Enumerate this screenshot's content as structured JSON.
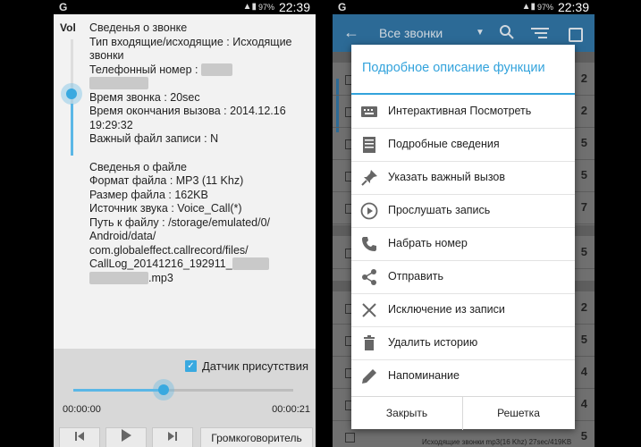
{
  "status_bar": {
    "app_letter": "G",
    "battery": "97%",
    "time": "22:39"
  },
  "left": {
    "vol_label": "Vol",
    "volume_level": 0.45,
    "call_info_header": "Сведенья о звонке",
    "type_line": "Тип входящие/исходящие : Исходящие звонки",
    "phone_label": "Телефонный номер :",
    "call_time_line": "Время звонка : 20sec",
    "end_time_line": "Время окончания вызова : 2014.12.16 19:29:32",
    "important_line": "Важный файл записи : N",
    "file_info_header": "Сведенья о файле",
    "format_line": "Формат файла : MP3 (11 Khz)",
    "size_line": "Размер файла : 162KB",
    "source_line": "Источник звука : Voice_Call(*)",
    "path_line": "Путь к файлу : /storage/emulated/0/ Android/data/ com.globaleffect.callrecord/files/ CallLog_20141216_192911_",
    "path_end": ".mp3",
    "sensor_label": "Датчик присутствия",
    "sensor_checked": true,
    "progress": 0.41,
    "time_start": "00:00:00",
    "time_end": "00:00:21",
    "speaker_label": "Громкоговоритель"
  },
  "right": {
    "appbar_title": "Все звонки",
    "back_icon": "arrow-left-icon",
    "bottom_row": "Исходящие звонки mp3(16 Khz) 27sec/419KB",
    "dialog": {
      "title": "Подробное описание функции",
      "items": [
        {
          "label": "Интерактивная Посмотреть",
          "icon": "keyboard-icon"
        },
        {
          "label": "Подробные сведения",
          "icon": "details-icon"
        },
        {
          "label": "Указать важный вызов",
          "icon": "pin-icon"
        },
        {
          "label": "Прослушать запись",
          "icon": "play-icon"
        },
        {
          "label": "Набрать номер",
          "icon": "phone-icon"
        },
        {
          "label": "Отправить",
          "icon": "share-icon"
        },
        {
          "label": "Исключение из записи",
          "icon": "close-icon"
        },
        {
          "label": "Удалить историю",
          "icon": "trash-icon"
        },
        {
          "label": "Напоминание",
          "icon": "pencil-icon"
        }
      ],
      "close_label": "Закрыть",
      "solution_label": "Решетка"
    }
  },
  "colors": {
    "accent": "#33a3dc",
    "appbar": "#2c6a96",
    "slider": "#39a9e0"
  }
}
